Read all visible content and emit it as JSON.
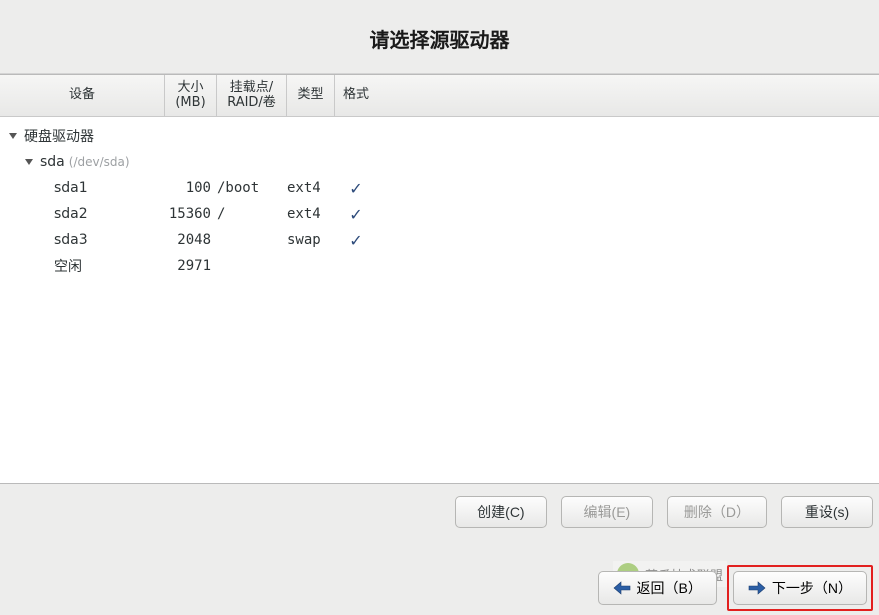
{
  "title": "请选择源驱动器",
  "columns": {
    "device": "设备",
    "size": "大小\n(MB)",
    "mount": "挂载点/\nRAID/卷",
    "type": "类型",
    "format": "格式"
  },
  "tree": {
    "root_label": "硬盘驱动器",
    "disk": {
      "name": "sda",
      "devpath": "(/dev/sda)"
    },
    "partitions": [
      {
        "name": "sda1",
        "size": "100",
        "mount": "/boot",
        "type": "ext4",
        "format": true
      },
      {
        "name": "sda2",
        "size": "15360",
        "mount": "/",
        "type": "ext4",
        "format": true
      },
      {
        "name": "sda3",
        "size": "2048",
        "mount": "",
        "type": "swap",
        "format": true
      },
      {
        "name": "空闲",
        "size": "2971",
        "mount": "",
        "type": "",
        "format": false
      }
    ]
  },
  "buttons": {
    "create": "创建(C)",
    "edit": "编辑(E)",
    "delete": "删除（D）",
    "reset": "重设(s)",
    "back": "返回（B）",
    "next": "下一步（N）"
  },
  "watermark": "莱瓜技术联盟"
}
